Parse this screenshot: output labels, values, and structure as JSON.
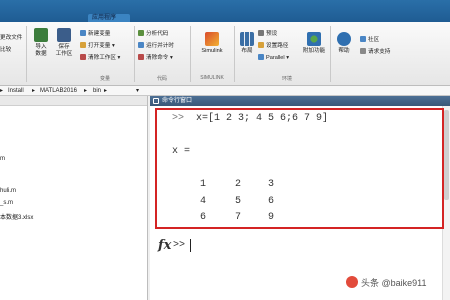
{
  "tabs": {
    "apps": "应用程序"
  },
  "ribbon": {
    "left_partial_1": "更改文件",
    "left_partial_2": "比较",
    "import_label_1": "导入",
    "import_label_2": "数据",
    "save_label_1": "保存",
    "save_label_2": "工作区",
    "new_var": "新建变量",
    "open_var": "打开变量",
    "clear_ws": "清除工作区",
    "analyze_code": "分析代码",
    "run_timer": "运行并计时",
    "clear_cmd": "清除命令",
    "simulink": "Simulink",
    "layout": "布局",
    "preferences": "预设",
    "set_path": "设置路径",
    "parallel": "Parallel",
    "addons": "附加功能",
    "help": "帮助",
    "community": "社区",
    "request_support": "请求支持",
    "group_variable": "变量",
    "group_code": "代码",
    "group_simulink": "SIMULINK",
    "group_env": "环境"
  },
  "pathbar": {
    "install": "Install",
    "matlab": "MATLAB2016",
    "bin": "bin"
  },
  "files": [
    "m",
    "huli.m",
    "_s.m",
    "本数据3.xlsx"
  ],
  "command_window": {
    "title": "命令行窗口",
    "prompt": ">>",
    "command": "x=[1 2 3; 4 5 6;6 7 9]",
    "output_var": "x =",
    "matrix": [
      [
        "1",
        "2",
        "3"
      ],
      [
        "4",
        "5",
        "6"
      ],
      [
        "6",
        "7",
        "9"
      ]
    ],
    "fx": "fx",
    "active_prompt": ">>"
  },
  "watermark": "头条 @baike911",
  "colors": {
    "highlight": "#d42424",
    "tab_bar": "#1f5c93",
    "cmd_title": "#3a5878"
  }
}
